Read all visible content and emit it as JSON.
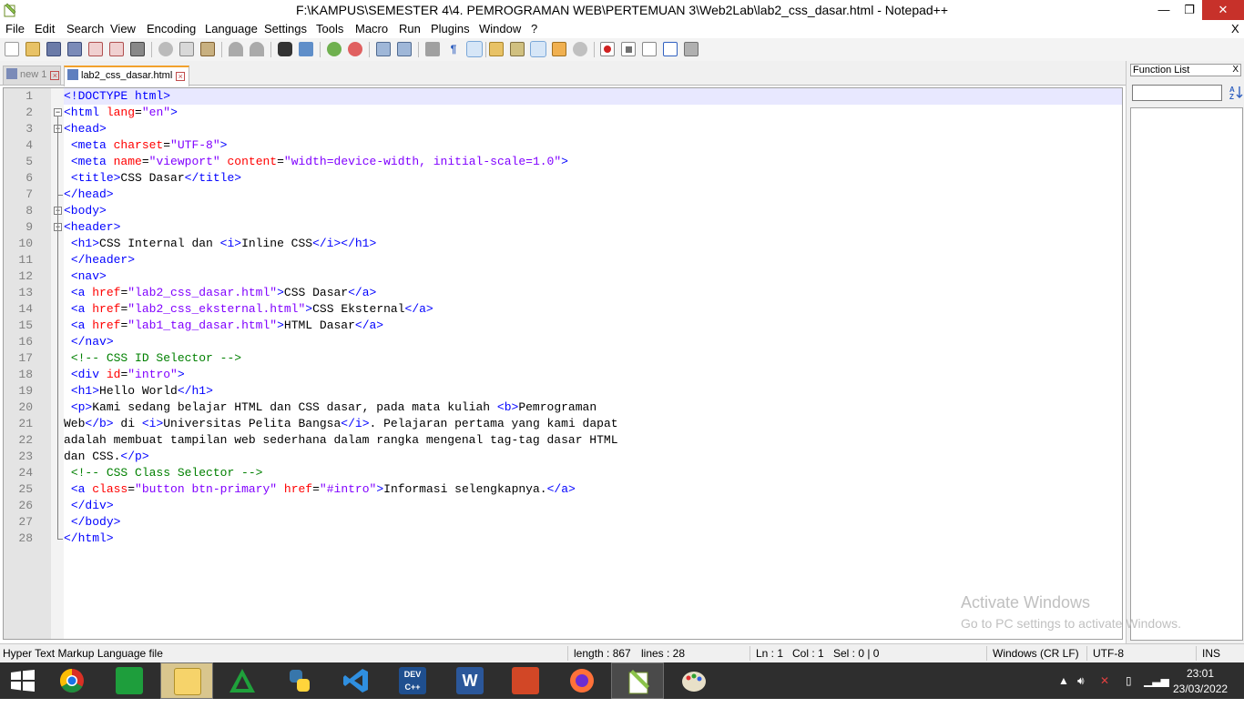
{
  "window": {
    "title": "F:\\KAMPUS\\SEMESTER 4\\4. PEMROGRAMAN WEB\\PERTEMUAN 3\\Web2Lab\\lab2_css_dasar.html - Notepad++",
    "minimize_glyph": "—",
    "maximize_glyph": "❐",
    "close_glyph": "✕",
    "menu_close_glyph": "X"
  },
  "menu": [
    "File",
    "Edit",
    "Search",
    "View",
    "Encoding",
    "Language",
    "Settings",
    "Tools",
    "Macro",
    "Run",
    "Plugins",
    "Window",
    "?"
  ],
  "toolbar": {
    "icons": [
      "new-file-icon",
      "open-file-icon",
      "save-icon",
      "save-all-icon",
      "close-icon",
      "close-all-icon",
      "print-icon",
      "cut-icon",
      "copy-icon",
      "paste-icon",
      "undo-icon",
      "redo-icon",
      "find-icon",
      "replace-icon",
      "zoom-in-icon",
      "zoom-out-icon",
      "sync-vertical-icon",
      "sync-horizontal-icon",
      "word-wrap-icon",
      "show-all-chars-icon",
      "indent-guide-icon",
      "user-language-icon",
      "document-map-icon",
      "function-list-icon",
      "folder-workspace-icon",
      "monitoring-icon",
      "record-macro-icon",
      "stop-macro-icon",
      "play-macro-icon",
      "run-macro-multiple-icon",
      "save-macro-icon"
    ]
  },
  "tabs": [
    {
      "label": "new 1",
      "active": false
    },
    {
      "label": "lab2_css_dasar.html",
      "active": true
    }
  ],
  "editor": {
    "lines": [
      [
        [
          "t",
          "<!DOCTYPE html>"
        ]
      ],
      [
        [
          "t",
          "<html "
        ],
        [
          "a",
          "lang"
        ],
        [
          "d",
          "="
        ],
        [
          "v",
          "\"en\""
        ],
        [
          "t",
          ">"
        ]
      ],
      [
        [
          "t",
          "<head>"
        ]
      ],
      [
        [
          "d",
          " "
        ],
        [
          "t",
          "<meta "
        ],
        [
          "a",
          "charset"
        ],
        [
          "d",
          "="
        ],
        [
          "v",
          "\"UTF-8\""
        ],
        [
          "t",
          ">"
        ]
      ],
      [
        [
          "d",
          " "
        ],
        [
          "t",
          "<meta "
        ],
        [
          "a",
          "name"
        ],
        [
          "d",
          "="
        ],
        [
          "v",
          "\"viewport\""
        ],
        [
          "d",
          " "
        ],
        [
          "a",
          "content"
        ],
        [
          "d",
          "="
        ],
        [
          "v",
          "\"width=device-width, initial-scale=1.0\""
        ],
        [
          "t",
          ">"
        ]
      ],
      [
        [
          "d",
          " "
        ],
        [
          "t",
          "<title>"
        ],
        [
          "d",
          "CSS Dasar"
        ],
        [
          "t",
          "</title>"
        ]
      ],
      [
        [
          "t",
          "</head>"
        ]
      ],
      [
        [
          "t",
          "<body>"
        ]
      ],
      [
        [
          "t",
          "<header>"
        ]
      ],
      [
        [
          "d",
          " "
        ],
        [
          "t",
          "<h1>"
        ],
        [
          "d",
          "CSS Internal dan "
        ],
        [
          "t",
          "<i>"
        ],
        [
          "d",
          "Inline CSS"
        ],
        [
          "t",
          "</i></h1>"
        ]
      ],
      [
        [
          "d",
          " "
        ],
        [
          "t",
          "</header>"
        ]
      ],
      [
        [
          "d",
          " "
        ],
        [
          "t",
          "<nav>"
        ]
      ],
      [
        [
          "d",
          " "
        ],
        [
          "t",
          "<a "
        ],
        [
          "a",
          "href"
        ],
        [
          "d",
          "="
        ],
        [
          "v",
          "\"lab2_css_dasar.html\""
        ],
        [
          "t",
          ">"
        ],
        [
          "d",
          "CSS Dasar"
        ],
        [
          "t",
          "</a>"
        ]
      ],
      [
        [
          "d",
          " "
        ],
        [
          "t",
          "<a "
        ],
        [
          "a",
          "href"
        ],
        [
          "d",
          "="
        ],
        [
          "v",
          "\"lab2_css_eksternal.html\""
        ],
        [
          "t",
          ">"
        ],
        [
          "d",
          "CSS Eksternal"
        ],
        [
          "t",
          "</a>"
        ]
      ],
      [
        [
          "d",
          " "
        ],
        [
          "t",
          "<a "
        ],
        [
          "a",
          "href"
        ],
        [
          "d",
          "="
        ],
        [
          "v",
          "\"lab1_tag_dasar.html\""
        ],
        [
          "t",
          ">"
        ],
        [
          "d",
          "HTML Dasar"
        ],
        [
          "t",
          "</a>"
        ]
      ],
      [
        [
          "d",
          " "
        ],
        [
          "t",
          "</nav>"
        ]
      ],
      [
        [
          "d",
          " "
        ],
        [
          "c",
          "<!-- CSS ID Selector -->"
        ]
      ],
      [
        [
          "d",
          " "
        ],
        [
          "t",
          "<div "
        ],
        [
          "a",
          "id"
        ],
        [
          "d",
          "="
        ],
        [
          "v",
          "\"intro\""
        ],
        [
          "t",
          ">"
        ]
      ],
      [
        [
          "d",
          " "
        ],
        [
          "t",
          "<h1>"
        ],
        [
          "d",
          "Hello World"
        ],
        [
          "t",
          "</h1>"
        ]
      ],
      [
        [
          "d",
          " "
        ],
        [
          "t",
          "<p>"
        ],
        [
          "d",
          "Kami sedang belajar HTML dan CSS dasar, pada mata kuliah "
        ],
        [
          "t",
          "<b>"
        ],
        [
          "d",
          "Pemrograman"
        ]
      ],
      [
        [
          "d",
          "Web"
        ],
        [
          "t",
          "</b>"
        ],
        [
          "d",
          " di "
        ],
        [
          "t",
          "<i>"
        ],
        [
          "d",
          "Universitas Pelita Bangsa"
        ],
        [
          "t",
          "</i>"
        ],
        [
          "d",
          ". Pelajaran pertama yang kami dapat"
        ]
      ],
      [
        [
          "d",
          "adalah membuat tampilan web sederhana dalam rangka mengenal tag-tag dasar HTML"
        ]
      ],
      [
        [
          "d",
          "dan CSS."
        ],
        [
          "t",
          "</p>"
        ]
      ],
      [
        [
          "d",
          " "
        ],
        [
          "c",
          "<!-- CSS Class Selector -->"
        ]
      ],
      [
        [
          "d",
          " "
        ],
        [
          "t",
          "<a "
        ],
        [
          "a",
          "class"
        ],
        [
          "d",
          "="
        ],
        [
          "v",
          "\"button btn-primary\""
        ],
        [
          "d",
          " "
        ],
        [
          "a",
          "href"
        ],
        [
          "d",
          "="
        ],
        [
          "v",
          "\"#intro\""
        ],
        [
          "t",
          ">"
        ],
        [
          "d",
          "Informasi selengkapnya."
        ],
        [
          "t",
          "</a>"
        ]
      ],
      [
        [
          "d",
          " "
        ],
        [
          "t",
          "</div>"
        ]
      ],
      [
        [
          "d",
          " "
        ],
        [
          "t",
          "</body>"
        ]
      ],
      [
        [
          "t",
          "</html>"
        ]
      ]
    ],
    "fold_open_lines": [
      2,
      3,
      8,
      9
    ],
    "fold_close_lines": [
      7,
      28
    ]
  },
  "function_list": {
    "title": "Function List",
    "close_glyph": "X",
    "search_value": "",
    "sort_icon": "sort-icon"
  },
  "watermark": {
    "line1": "Activate Windows",
    "line2": "Go to PC settings to activate Windows."
  },
  "statusbar": {
    "file_type": "Hyper Text Markup Language file",
    "length": "length : 867",
    "lines": "lines : 28",
    "ln": "Ln : 1",
    "col": "Col : 1",
    "sel": "Sel : 0 | 0",
    "eol": "Windows (CR LF)",
    "encoding": "UTF-8",
    "mode": "INS"
  },
  "taskbar": {
    "apps": [
      "windows-start-icon",
      "chrome-icon",
      "store-icon",
      "file-explorer-icon",
      "gradle-icon",
      "python-icon",
      "vscode-icon",
      "dev-cpp-icon",
      "word-icon",
      "powerpoint-icon",
      "firefox-icon",
      "notepadpp-icon",
      "paint-icon"
    ],
    "dev_cpp_label": "DEV C++",
    "word_label": "W",
    "time": "23:01",
    "date": "23/03/2022"
  },
  "colors": {
    "tag": "#0000ff",
    "attribute": "#ff0000",
    "value": "#8000ff",
    "comment": "#008000",
    "current_line": "#e8e8ff",
    "taskbar": "#2e2e2e"
  }
}
